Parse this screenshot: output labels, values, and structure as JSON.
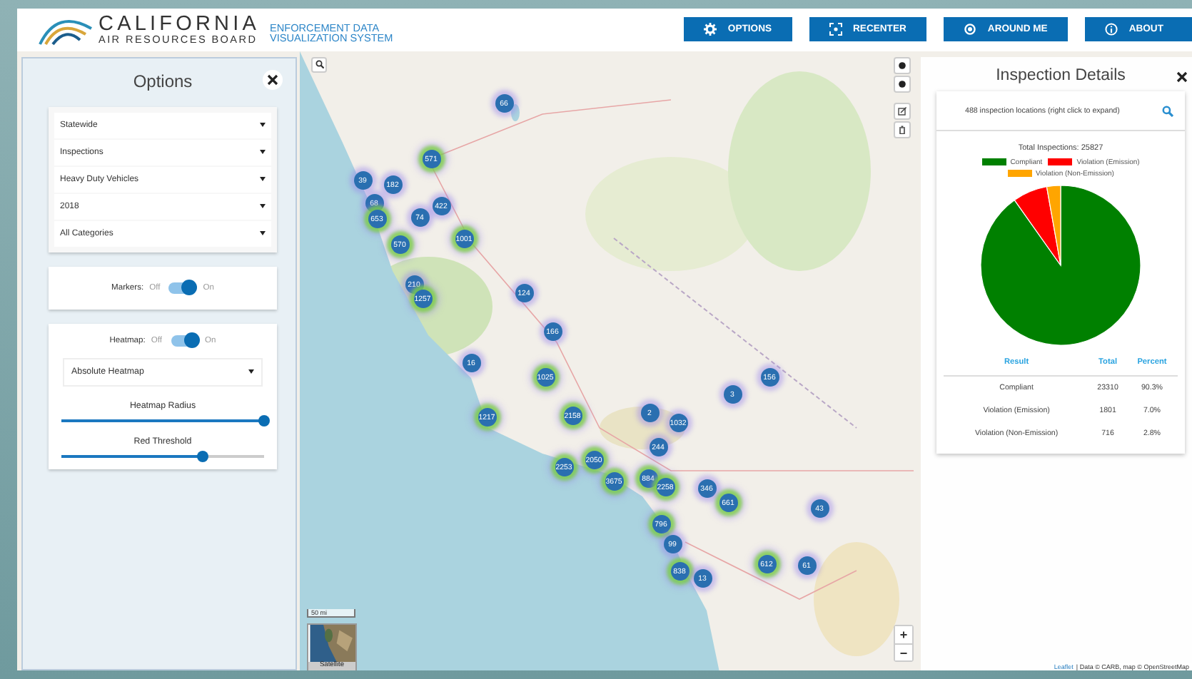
{
  "header": {
    "logo_title": "CALIFORNIA",
    "logo_subtitle": "AIR RESOURCES BOARD",
    "system_line1": "ENFORCEMENT DATA",
    "system_line2": "VISUALIZATION SYSTEM",
    "buttons": [
      {
        "label": "OPTIONS"
      },
      {
        "label": "RECENTER"
      },
      {
        "label": "AROUND ME"
      },
      {
        "label": "ABOUT"
      }
    ]
  },
  "options_panel": {
    "title": "Options",
    "dropdowns": [
      "Statewide",
      "Inspections",
      "Heavy Duty Vehicles",
      "2018",
      "All Categories"
    ],
    "markers_toggle": {
      "label": "Markers:",
      "off_label": "Off",
      "on_label": "On",
      "on": true
    },
    "heatmap_toggle": {
      "label": "Heatmap:",
      "off_label": "Off",
      "on_label": "On",
      "on": true
    },
    "heatmap_mode": "Absolute Heatmap",
    "sliders": [
      {
        "label": "Heatmap Radius",
        "level": 1.0
      },
      {
        "label": "Red Threshold",
        "level": 0.7
      }
    ]
  },
  "map": {
    "clusters": [
      "66",
      "571",
      "39",
      "182",
      "68",
      "653",
      "74",
      "422",
      "570",
      "1001",
      "210",
      "1257",
      "124",
      "166",
      "16",
      "1025",
      "156",
      "3",
      "2",
      "1032",
      "1217",
      "2158",
      "244",
      "2050",
      "2253",
      "3675",
      "884",
      "2258",
      "346",
      "661",
      "43",
      "796",
      "99",
      "838",
      "13",
      "612",
      "61"
    ],
    "scale": "50 mi",
    "layer_button": "Satellite",
    "zoom_in": "+",
    "zoom_out": "−",
    "attribution_link": "Leaflet",
    "attribution": "| Data © CARB, map © OpenStreetMap"
  },
  "details_panel": {
    "title": "Inspection Details",
    "locations_text": "488 inspection locations (right click to expand)",
    "total_text": "Total Inspections: 25827",
    "legend": [
      {
        "label": "Compliant",
        "color": "#008000"
      },
      {
        "label": "Violation (Emission)",
        "color": "#ff0000"
      },
      {
        "label": "Violation (Non-Emission)",
        "color": "#ffa500"
      }
    ],
    "chart_data": {
      "type": "pie",
      "values": [
        90.3,
        7.0,
        2.8
      ]
    },
    "table": {
      "columns": [
        "Result",
        "Total",
        "Percent"
      ],
      "rows": [
        [
          "Compliant",
          "23310",
          "90.3%"
        ],
        [
          "Violation (Emission)",
          "1801",
          "7.0%"
        ],
        [
          "Violation (Non-Emission)",
          "716",
          "2.8%"
        ]
      ]
    }
  }
}
